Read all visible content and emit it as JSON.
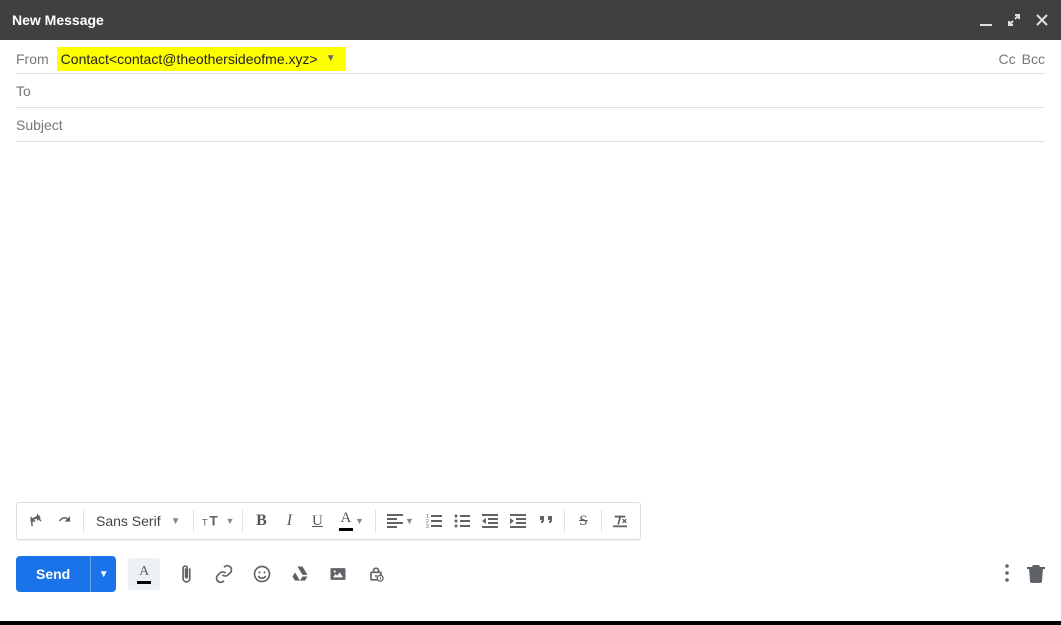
{
  "titlebar": {
    "title": "New Message"
  },
  "fields": {
    "from_label": "From",
    "from_value": "Contact<contact@theothersideofme.xyz>",
    "to_label": "To",
    "to_value": "",
    "subject_placeholder": "Subject",
    "subject_value": "",
    "cc_label": "Cc",
    "bcc_label": "Bcc"
  },
  "format_toolbar": {
    "font_family": "Sans Serif"
  },
  "actions": {
    "send_label": "Send"
  },
  "icons": {
    "minimize": "minimize-icon",
    "popout": "popout-icon",
    "close": "close-icon",
    "undo": "undo-icon",
    "redo": "redo-icon",
    "font_size": "font-size-icon",
    "bold": "bold-icon",
    "italic": "italic-icon",
    "underline": "underline-icon",
    "text_color": "text-color-icon",
    "align": "align-icon",
    "numbered_list": "numbered-list-icon",
    "bulleted_list": "bulleted-list-icon",
    "indent_less": "indent-less-icon",
    "indent_more": "indent-more-icon",
    "quote": "quote-icon",
    "strike": "strikethrough-icon",
    "clear_format": "clear-format-icon",
    "formatting_toggle": "formatting-toggle-icon",
    "attach": "attach-icon",
    "link": "link-icon",
    "emoji": "emoji-icon",
    "drive": "drive-icon",
    "photo": "photo-icon",
    "confidential": "confidential-icon",
    "more": "more-icon",
    "trash": "trash-icon"
  }
}
